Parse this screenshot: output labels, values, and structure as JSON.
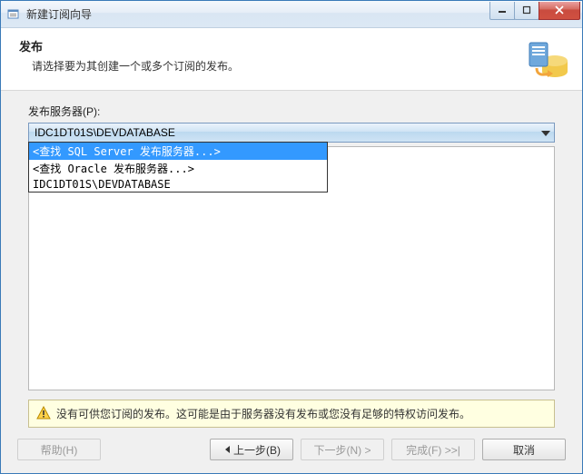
{
  "window": {
    "title": "新建订阅向导"
  },
  "header": {
    "title": "发布",
    "subtitle": "请选择要为其创建一个或多个订阅的发布。"
  },
  "form": {
    "publisher_label": "发布服务器(P):",
    "publisher_value": "IDC1DT01S\\DEVDATABASE"
  },
  "dropdown": {
    "options": [
      {
        "label": "<查找 SQL Server 发布服务器...>",
        "selected": true
      },
      {
        "label": "<查找 Oracle 发布服务器...>",
        "selected": false
      },
      {
        "label": "IDC1DT01S\\DEVDATABASE",
        "selected": false
      }
    ]
  },
  "warning": {
    "text": "没有可供您订阅的发布。这可能是由于服务器没有发布或您没有足够的特权访问发布。"
  },
  "buttons": {
    "help": "帮助(H)",
    "back": "上一步(B)",
    "next": "下一步(N) >",
    "finish": "完成(F) >>|",
    "cancel": "取消"
  }
}
